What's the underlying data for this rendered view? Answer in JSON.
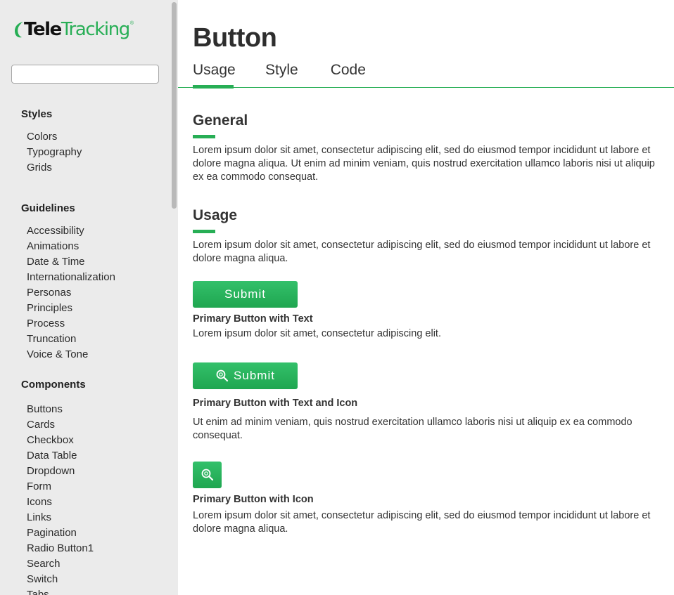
{
  "sidebar": {
    "logo": {
      "part1": "Tele",
      "part2": "Tracking",
      "mark": "®"
    },
    "search": {
      "value": "",
      "placeholder": ""
    },
    "sections": [
      {
        "heading": "Styles",
        "items": [
          "Colors",
          "Typography",
          "Grids"
        ]
      },
      {
        "heading": "Guidelines",
        "items": [
          "Accessibility",
          "Animations",
          "Date & Time",
          "Internationalization",
          "Personas",
          "Principles",
          "Process",
          "Truncation",
          "Voice & Tone"
        ]
      },
      {
        "heading": "Components",
        "items": [
          "Buttons",
          "Cards",
          "Checkbox",
          "Data Table",
          "Dropdown",
          "Form",
          "Icons",
          "Links",
          "Pagination",
          "Radio Button1",
          "Search",
          "Switch",
          "Tabs"
        ]
      }
    ]
  },
  "main": {
    "title": "Button",
    "tabs": [
      "Usage",
      "Style",
      "Code"
    ],
    "general": {
      "title": "General",
      "text": "Lorem ipsum dolor sit amet, consectetur adipiscing elit, sed do eiusmod tempor incididunt ut labore et dolore magna aliqua. Ut enim ad minim veniam, quis nostrud exercitation ullamco laboris nisi ut aliquip ex ea commodo consequat."
    },
    "usage": {
      "title": "Usage",
      "text": "Lorem ipsum dolor sit amet, consectetur adipiscing elit, sed do eiusmod tempor incididunt ut labore et dolore magna aliqua."
    },
    "examples": [
      {
        "button_label": "Submit",
        "label": "Primary Button with Text",
        "text": "Lorem ipsum dolor sit amet, consectetur adipiscing elit."
      },
      {
        "button_label": "Submit",
        "button_icon": "search-icon",
        "label": "Primary Button with Text and Icon",
        "text": "Ut enim ad minim veniam, quis nostrud exercitation ullamco laboris nisi ut aliquip ex ea commodo consequat."
      },
      {
        "button_icon": "search-icon",
        "label": "Primary Button with Icon",
        "text": "Lorem ipsum dolor sit amet, consectetur adipiscing elit, sed do eiusmod tempor incididunt ut labore et dolore magna aliqua."
      }
    ]
  },
  "colors": {
    "accent": "#27ae55",
    "sidebar_bg": "#ebebeb",
    "text": "#333333"
  }
}
